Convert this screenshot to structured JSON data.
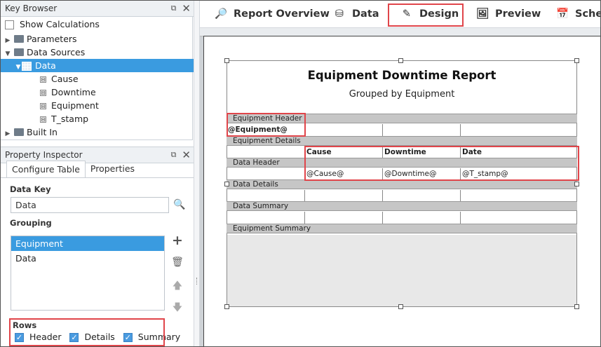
{
  "key_browser": {
    "title": "Key Browser",
    "show_calculations": "Show Calculations",
    "tree": {
      "parameters": "Parameters",
      "data_sources": "Data Sources",
      "data": "Data",
      "fields": [
        "Cause",
        "Downtime",
        "Equipment",
        "T_stamp"
      ],
      "built_in": "Built In"
    }
  },
  "property_inspector": {
    "title": "Property Inspector",
    "tabs": [
      "Configure Table",
      "Properties"
    ],
    "data_key_label": "Data Key",
    "data_key_value": "Data",
    "grouping_label": "Grouping",
    "grouping_items": [
      "Equipment",
      "Data"
    ],
    "rows_label": "Rows",
    "rows": [
      "Header",
      "Details",
      "Summary"
    ]
  },
  "toolbar": {
    "items": [
      "Report Overview",
      "Data",
      "Design",
      "Preview",
      "Sched"
    ]
  },
  "report": {
    "title": "Equipment Downtime Report",
    "subtitle": "Grouped by Equipment",
    "bands": {
      "equipment_header": "Equipment Header",
      "equipment_details": "Equipment Details",
      "data_header": "Data Header",
      "data_details": "Data Details",
      "data_summary": "Data Summary",
      "equipment_summary": "Equipment Summary"
    },
    "equipment_key": "@Equipment@",
    "columns": [
      "Cause",
      "Downtime",
      "Date"
    ],
    "keys": [
      "@Cause@",
      "@Downtime@",
      "@T_stamp@"
    ]
  },
  "colors": {
    "accent": "#3a9be0",
    "highlight": "#e0454a",
    "band": "#c6c6c6"
  }
}
